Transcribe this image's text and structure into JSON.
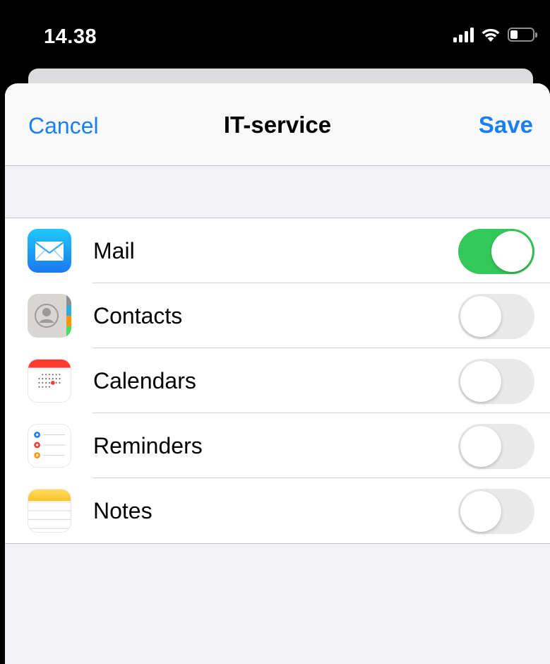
{
  "status_bar": {
    "time": "14.38",
    "icons": [
      "cellular-signal-icon",
      "wifi-icon",
      "battery-icon"
    ]
  },
  "nav": {
    "cancel_label": "Cancel",
    "title": "IT-service",
    "save_label": "Save"
  },
  "colors": {
    "accent": "#1c7ff1",
    "toggle_on": "#34c759",
    "toggle_off": "#e9e9ea",
    "background": "#f2f2f7"
  },
  "services": [
    {
      "label": "Mail",
      "icon": "mail-app-icon",
      "enabled": true
    },
    {
      "label": "Contacts",
      "icon": "contacts-app-icon",
      "enabled": false
    },
    {
      "label": "Calendars",
      "icon": "calendar-app-icon",
      "enabled": false
    },
    {
      "label": "Reminders",
      "icon": "reminders-app-icon",
      "enabled": false
    },
    {
      "label": "Notes",
      "icon": "notes-app-icon",
      "enabled": false
    }
  ]
}
